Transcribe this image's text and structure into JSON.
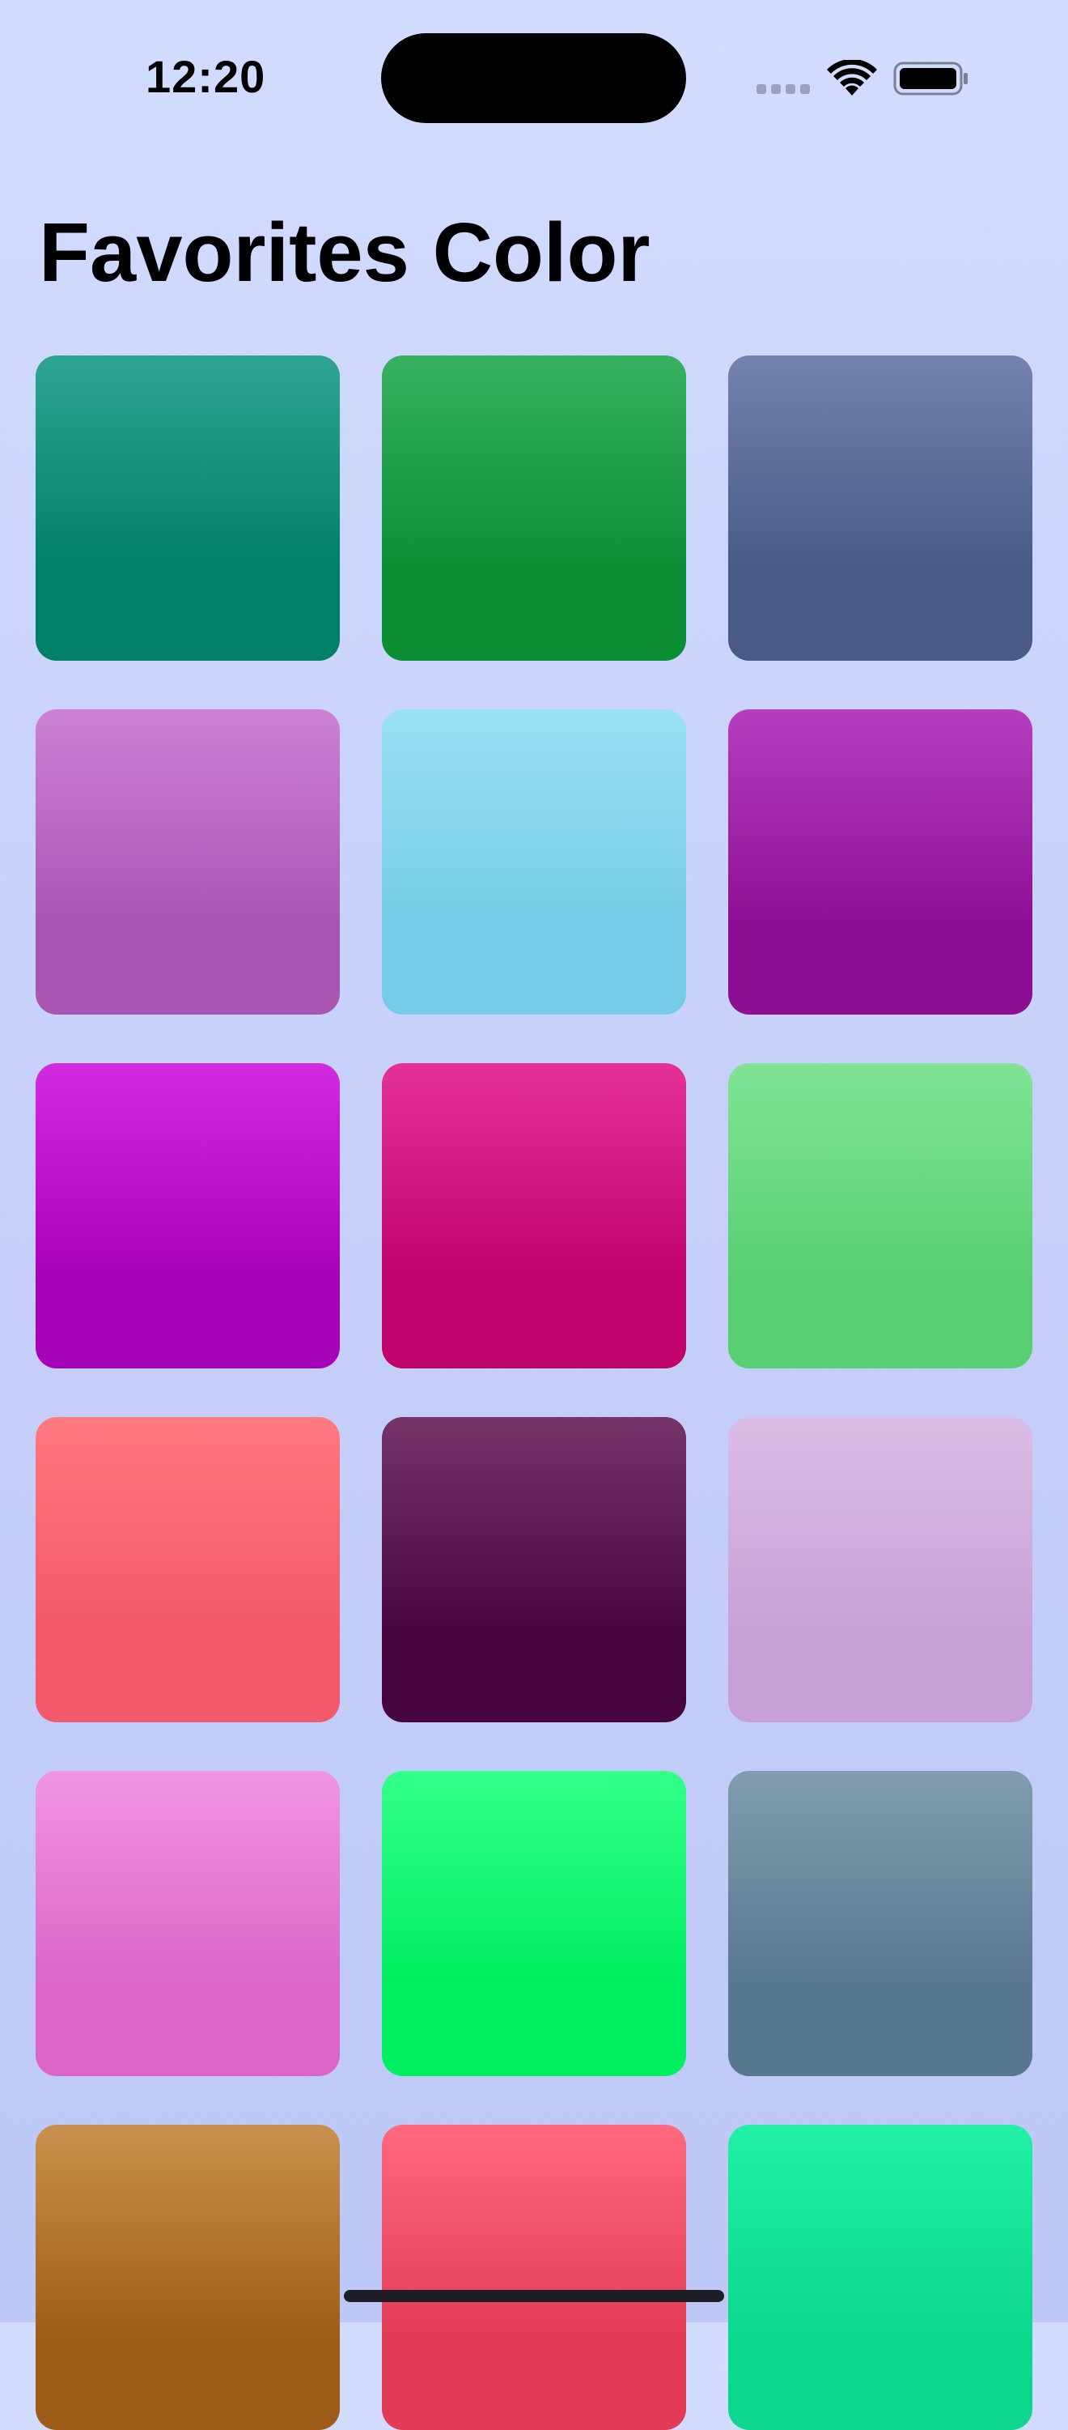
{
  "status_bar": {
    "time": "12:20",
    "icons": [
      "cellular-signal-icon",
      "wifi-icon",
      "battery-icon"
    ]
  },
  "header": {
    "title": "Favorites Color"
  },
  "colors": [
    {
      "top": "#2ea593",
      "bottom": "#027f67"
    },
    {
      "top": "#37b160",
      "bottom": "#0c8e35"
    },
    {
      "top": "#7483ad",
      "bottom": "#495a87"
    },
    {
      "top": "#cb82d4",
      "bottom": "#a955b3"
    },
    {
      "top": "#9be1f4",
      "bottom": "#75cce6"
    },
    {
      "top": "#b53ec0",
      "bottom": "#8e0f94"
    },
    {
      "top": "#d22be1",
      "bottom": "#a602b7"
    },
    {
      "top": "#e4329a",
      "bottom": "#c0026c"
    },
    {
      "top": "#80e396",
      "bottom": "#59cf73"
    },
    {
      "top": "#ff7882",
      "bottom": "#f2596a"
    },
    {
      "top": "#743569",
      "bottom": "#48063e"
    },
    {
      "top": "#dcbde5",
      "bottom": "#c7a1d6"
    },
    {
      "top": "#f194e3",
      "bottom": "#db66c7"
    },
    {
      "top": "#32ff8a",
      "bottom": "#00ee61"
    },
    {
      "top": "#819caf",
      "bottom": "#58788e"
    },
    {
      "top": "#c8914d",
      "bottom": "#9f5c18"
    },
    {
      "top": "#ff687f",
      "bottom": "#e23b56"
    },
    {
      "top": "#21f0a6",
      "bottom": "#0fd68f"
    }
  ]
}
